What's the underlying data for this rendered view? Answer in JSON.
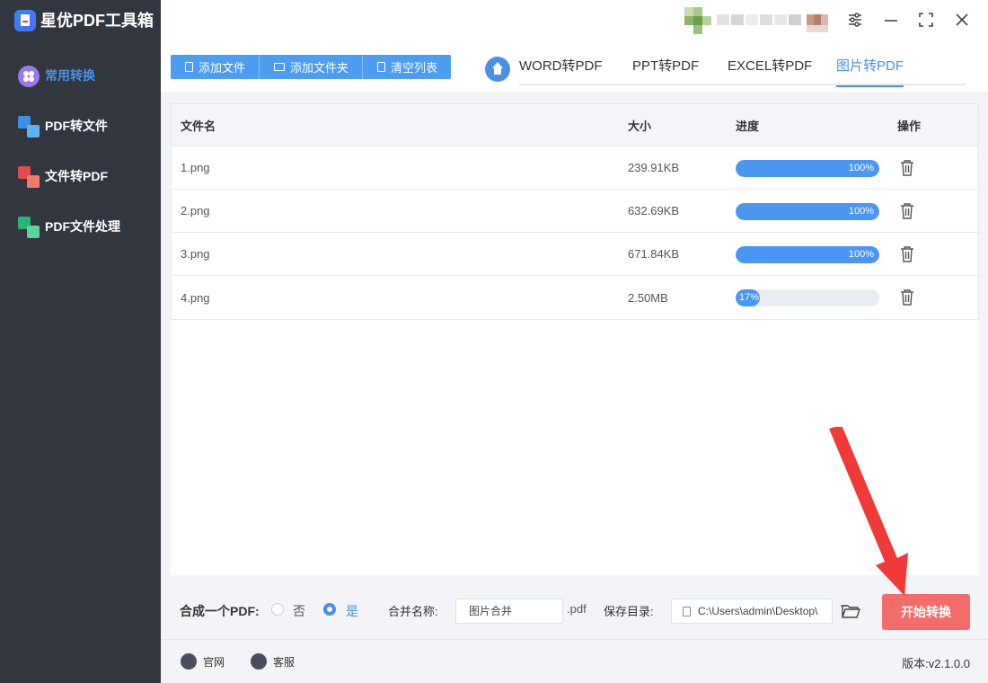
{
  "app": {
    "title": "星优PDF工具箱"
  },
  "sidebar": {
    "items": [
      {
        "label": "常用转换",
        "icon": "flower-circle-icon",
        "active": true
      },
      {
        "label": "PDF转文件",
        "icon": "pdf-to-file-icon"
      },
      {
        "label": "文件转PDF",
        "icon": "file-to-pdf-icon"
      },
      {
        "label": "PDF文件处理",
        "icon": "pdf-process-icon"
      }
    ]
  },
  "window_controls": {
    "settings": "sliders-icon",
    "minimize": "minimize-icon",
    "maximize": "maximize-icon",
    "close": "close-icon"
  },
  "toolbar": {
    "add_file": "添加文件",
    "add_folder": "添加文件夹",
    "clear_list": "清空列表"
  },
  "tabs": [
    {
      "label": "WORD转PDF"
    },
    {
      "label": "PPT转PDF"
    },
    {
      "label": "EXCEL转PDF"
    },
    {
      "label": "图片转PDF",
      "active": true
    }
  ],
  "table": {
    "headers": {
      "name": "文件名",
      "size": "大小",
      "progress": "进度",
      "action": "操作"
    },
    "rows": [
      {
        "name": "1.png",
        "size": "239.91KB",
        "progress": 100,
        "progress_text": "100%"
      },
      {
        "name": "2.png",
        "size": "632.69KB",
        "progress": 100,
        "progress_text": "100%"
      },
      {
        "name": "3.png",
        "size": "671.84KB",
        "progress": 100,
        "progress_text": "100%"
      },
      {
        "name": "4.png",
        "size": "2.50MB",
        "progress": 17,
        "progress_text": "17%"
      }
    ]
  },
  "options": {
    "merge_label": "合成一个PDF:",
    "no_label": "否",
    "yes_label": "是",
    "merge_selected": "是",
    "merge_name_label": "合并名称:",
    "merge_name_value": "图片合并",
    "ext": ".pdf",
    "save_dir_label": "保存目录:",
    "save_dir_value": "C:\\Users\\admin\\Desktop\\",
    "start_button": "开始转换"
  },
  "footer": {
    "website": "官网",
    "service": "客服",
    "version": "版本:v2.1.0.0"
  },
  "colors": {
    "accent": "#4a90e2",
    "start": "#f26c6c",
    "sidebar": "#32363f",
    "annotation_arrow": "#f03a3a"
  }
}
